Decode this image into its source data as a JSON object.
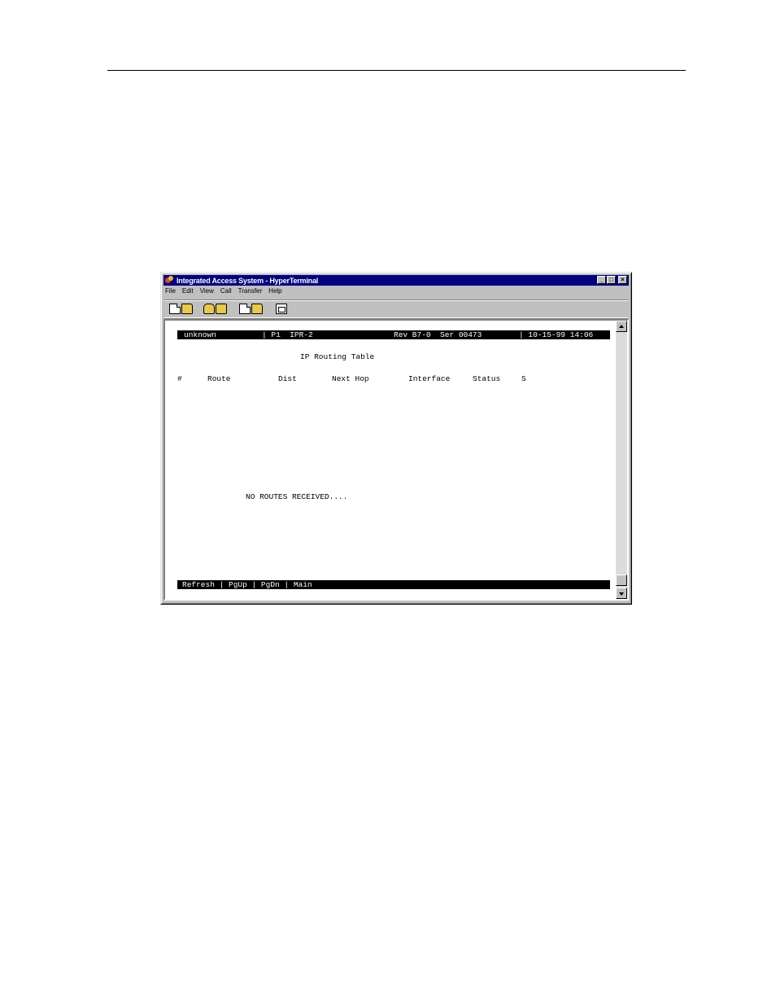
{
  "window": {
    "title": "Integrated Access System - HyperTerminal",
    "controls": {
      "minimize": "_",
      "maximize": "□",
      "close": "×"
    }
  },
  "menu": [
    "File",
    "Edit",
    "View",
    "Call",
    "Transfer",
    "Help"
  ],
  "toolbar": [
    "new-document-icon",
    "open-folder-icon",
    "dial-phone-icon",
    "hangup-phone-icon",
    "send-icon",
    "receive-icon",
    "properties-icon"
  ],
  "terminal": {
    "header": {
      "name": "unknown",
      "port": "| P1  IPR-2",
      "rev": "Rev B7-0  Ser 00473",
      "datetime": "| 10-15-99 14:06"
    },
    "title": "IP Routing Table",
    "columns": [
      "#",
      "Route",
      "Dist",
      "Next Hop",
      "Interface",
      "Status",
      "S"
    ],
    "message": "NO ROUTES RECEIVED....",
    "footer": "Refresh | PgUp | PgDn | Main"
  },
  "colors": {
    "titlebar": "#000080",
    "window": "#c0c0c0",
    "terminal_bg": "#ffffff",
    "bar_bg": "#000000"
  }
}
